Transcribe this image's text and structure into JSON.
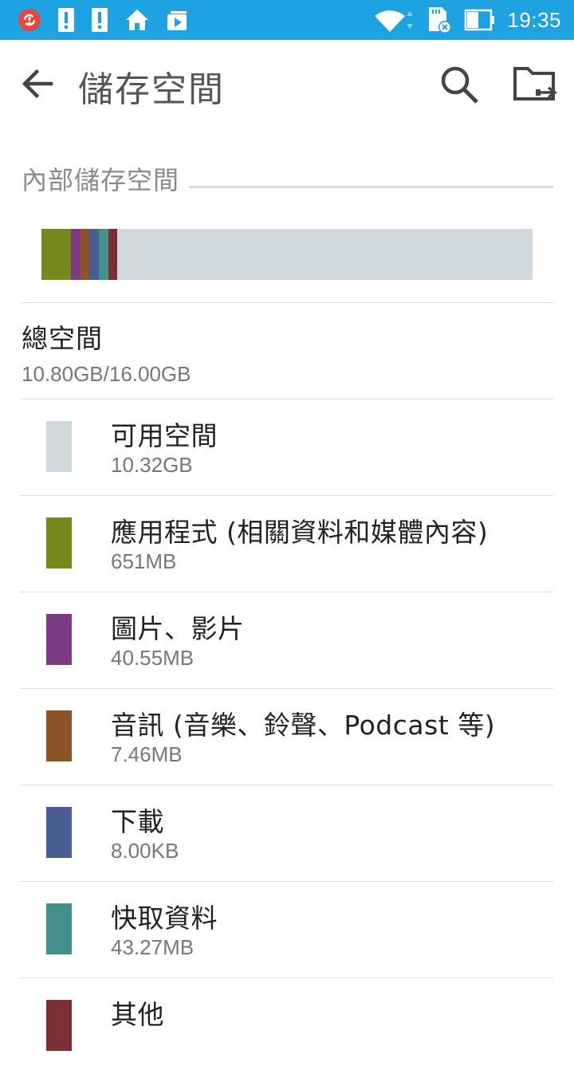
{
  "status_bar": {
    "time": "19:35",
    "colors": {
      "background": "#1ea3e2",
      "notification_badge": "#e8463a"
    }
  },
  "app_bar": {
    "title": "儲存空間"
  },
  "section": {
    "title": "內部儲存空間"
  },
  "total": {
    "label": "總空間",
    "value": "10.80GB/16.00GB"
  },
  "usage_segments": [
    {
      "color": "#76891c",
      "fraction": 0.06
    },
    {
      "color": "#7c3a83",
      "fraction": 0.019
    },
    {
      "color": "#8b5428",
      "fraction": 0.019
    },
    {
      "color": "#475e92",
      "fraction": 0.019
    },
    {
      "color": "#429089",
      "fraction": 0.019
    },
    {
      "color": "#7c2f33",
      "fraction": 0.019
    }
  ],
  "free_color": "#d0d9dc",
  "items": [
    {
      "label": "可用空間",
      "value": "10.32GB",
      "color": "#d0d9dc"
    },
    {
      "label": "應用程式 (相關資料和媒體內容)",
      "value": "651MB",
      "color": "#76891c"
    },
    {
      "label": "圖片、影片",
      "value": "40.55MB",
      "color": "#7c3a83"
    },
    {
      "label": "音訊 (音樂、鈴聲、Podcast 等)",
      "value": "7.46MB",
      "color": "#8b5428"
    },
    {
      "label": "下載",
      "value": "8.00KB",
      "color": "#475e92"
    },
    {
      "label": "快取資料",
      "value": "43.27MB",
      "color": "#429089"
    },
    {
      "label": "其他",
      "value": "",
      "color": "#7c2f33"
    }
  ]
}
